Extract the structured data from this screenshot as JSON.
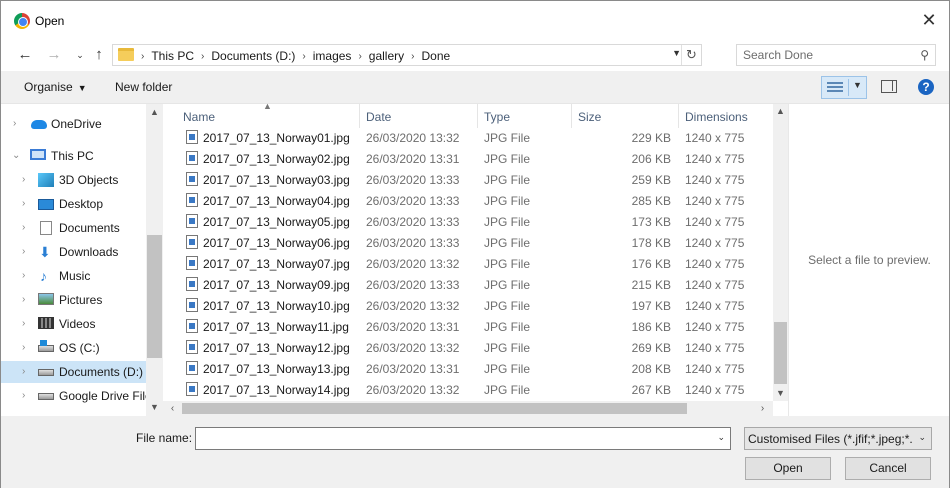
{
  "window": {
    "title": "Open"
  },
  "address": {
    "crumbs": [
      "This PC",
      "Documents (D:)",
      "images",
      "gallery",
      "Done"
    ]
  },
  "search": {
    "placeholder": "Search Done"
  },
  "toolbar": {
    "organise": "Organise",
    "new_folder": "New folder"
  },
  "nav": {
    "items": [
      {
        "label": "OneDrive",
        "icon": "cloud-icon",
        "level": 0
      },
      {
        "label": "This PC",
        "icon": "computer-icon",
        "level": 0,
        "expanded": true
      },
      {
        "label": "3D Objects",
        "icon": "cube-icon",
        "level": 1
      },
      {
        "label": "Desktop",
        "icon": "desktop-icon",
        "level": 1
      },
      {
        "label": "Documents",
        "icon": "document-icon",
        "level": 1
      },
      {
        "label": "Downloads",
        "icon": "download-icon",
        "level": 1
      },
      {
        "label": "Music",
        "icon": "music-icon",
        "level": 1
      },
      {
        "label": "Pictures",
        "icon": "pictures-icon",
        "level": 1
      },
      {
        "label": "Videos",
        "icon": "video-icon",
        "level": 1
      },
      {
        "label": "OS (C:)",
        "icon": "os-drive-icon",
        "level": 1
      },
      {
        "label": "Documents (D:)",
        "icon": "drive-icon",
        "level": 1,
        "selected": true
      },
      {
        "label": "Google Drive File",
        "icon": "drive-icon",
        "level": 1
      }
    ]
  },
  "columns": {
    "name": "Name",
    "date": "Date",
    "type": "Type",
    "size": "Size",
    "dimensions": "Dimensions"
  },
  "files": [
    {
      "name": "2017_07_13_Norway01.jpg",
      "date": "26/03/2020 13:32",
      "type": "JPG File",
      "size": "229 KB",
      "dim": "1240 x 775"
    },
    {
      "name": "2017_07_13_Norway02.jpg",
      "date": "26/03/2020 13:31",
      "type": "JPG File",
      "size": "206 KB",
      "dim": "1240 x 775"
    },
    {
      "name": "2017_07_13_Norway03.jpg",
      "date": "26/03/2020 13:33",
      "type": "JPG File",
      "size": "259 KB",
      "dim": "1240 x 775"
    },
    {
      "name": "2017_07_13_Norway04.jpg",
      "date": "26/03/2020 13:33",
      "type": "JPG File",
      "size": "285 KB",
      "dim": "1240 x 775"
    },
    {
      "name": "2017_07_13_Norway05.jpg",
      "date": "26/03/2020 13:33",
      "type": "JPG File",
      "size": "173 KB",
      "dim": "1240 x 775"
    },
    {
      "name": "2017_07_13_Norway06.jpg",
      "date": "26/03/2020 13:33",
      "type": "JPG File",
      "size": "178 KB",
      "dim": "1240 x 775"
    },
    {
      "name": "2017_07_13_Norway07.jpg",
      "date": "26/03/2020 13:32",
      "type": "JPG File",
      "size": "176 KB",
      "dim": "1240 x 775"
    },
    {
      "name": "2017_07_13_Norway09.jpg",
      "date": "26/03/2020 13:33",
      "type": "JPG File",
      "size": "215 KB",
      "dim": "1240 x 775"
    },
    {
      "name": "2017_07_13_Norway10.jpg",
      "date": "26/03/2020 13:32",
      "type": "JPG File",
      "size": "197 KB",
      "dim": "1240 x 775"
    },
    {
      "name": "2017_07_13_Norway11.jpg",
      "date": "26/03/2020 13:31",
      "type": "JPG File",
      "size": "186 KB",
      "dim": "1240 x 775"
    },
    {
      "name": "2017_07_13_Norway12.jpg",
      "date": "26/03/2020 13:32",
      "type": "JPG File",
      "size": "269 KB",
      "dim": "1240 x 775"
    },
    {
      "name": "2017_07_13_Norway13.jpg",
      "date": "26/03/2020 13:31",
      "type": "JPG File",
      "size": "208 KB",
      "dim": "1240 x 775"
    },
    {
      "name": "2017_07_13_Norway14.jpg",
      "date": "26/03/2020 13:32",
      "type": "JPG File",
      "size": "267 KB",
      "dim": "1240 x 775"
    }
  ],
  "preview": {
    "text": "Select a file to preview."
  },
  "bottom": {
    "file_name_label": "File name:",
    "file_name_value": "",
    "filter": "Customised Files (*.jfif;*.jpeg;*.",
    "open": "Open",
    "cancel": "Cancel"
  },
  "colors": {
    "selection": "#cce4f7",
    "accent": "#1b65c2",
    "header_text": "#4c607a"
  }
}
